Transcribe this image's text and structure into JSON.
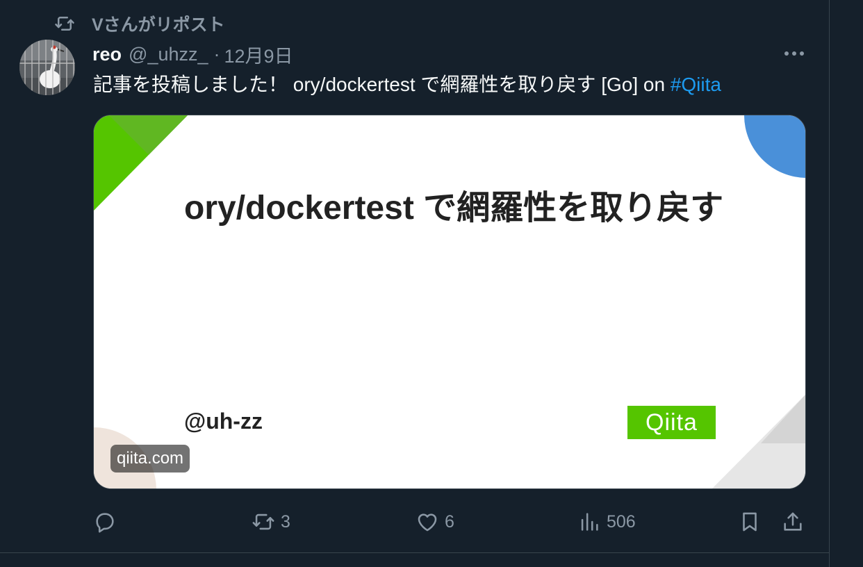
{
  "repost": {
    "icon": "repost-icon",
    "label": "Vさんがリポスト"
  },
  "tweet": {
    "author": {
      "name": "reo",
      "handle": "@_uhzz_",
      "avatar": "avatar-crane-photo"
    },
    "separator": "·",
    "timestamp": "12月9日",
    "more_icon": "more-dots-icon",
    "text": "記事を投稿しました！ ory/dockertest で網羅性を取り戻す [Go] on ",
    "hashtag": "#Qiita"
  },
  "card": {
    "title": "ory/dockertest で網羅性を取り戻す",
    "author": "@uh-zz",
    "logo_text": "Qiita",
    "domain": "qiita.com",
    "colors": {
      "green": "#55c500",
      "blue": "#4a90d9",
      "peach": "#efe4dc",
      "gray": "#e6e6e6"
    }
  },
  "actions": {
    "reply": {
      "icon": "reply-icon",
      "count": ""
    },
    "repost": {
      "icon": "repost-icon",
      "count": "3"
    },
    "like": {
      "icon": "heart-icon",
      "count": "6"
    },
    "views": {
      "icon": "views-chart-icon",
      "count": "506"
    },
    "bookmark": {
      "icon": "bookmark-icon"
    },
    "share": {
      "icon": "share-icon"
    }
  },
  "colors": {
    "background": "#15202b",
    "text": "#f7f9f9",
    "muted": "#8b98a5",
    "accent": "#1d9bf0",
    "border": "#38444d"
  }
}
